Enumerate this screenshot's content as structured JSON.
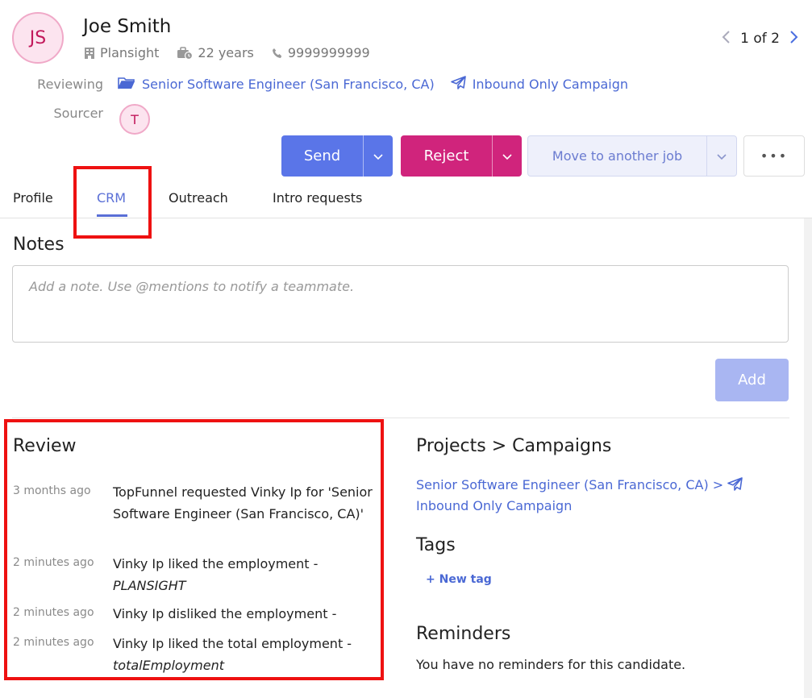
{
  "candidate": {
    "initials": "JS",
    "name": "Joe Smith",
    "company": "Plansight",
    "experience": "22 years",
    "phone": "9999999999"
  },
  "pager": {
    "text": "1 of 2"
  },
  "reviewing": {
    "label": "Reviewing",
    "job": "Senior Software Engineer (San Francisco, CA)",
    "campaign": "Inbound Only Campaign"
  },
  "sourcer": {
    "label": "Sourcer",
    "initial": "T"
  },
  "actions": {
    "send": "Send",
    "reject": "Reject",
    "move": "Move to another job",
    "more": "•••"
  },
  "tabs": [
    "Profile",
    "CRM",
    "Outreach",
    "Intro requests"
  ],
  "notes": {
    "title": "Notes",
    "placeholder": "Add a note. Use @mentions to notify a teammate.",
    "add": "Add"
  },
  "review": {
    "title": "Review",
    "items": [
      {
        "time": "3 months ago",
        "text": "TopFunnel requested Vinky Ip for 'Senior Software Engineer (San Francisco, CA)'",
        "italic": ""
      },
      {
        "time": "2 minutes ago",
        "text": "Vinky Ip liked the employment - ",
        "italic": "PLANSIGHT"
      },
      {
        "time": "2 minutes ago",
        "text": "Vinky Ip disliked the employment - ",
        "italic": ""
      },
      {
        "time": "2 minutes ago",
        "text": "Vinky Ip liked the total employment - ",
        "italic": "totalEmployment"
      }
    ]
  },
  "projects": {
    "title": "Projects > Campaigns",
    "job": "Senior Software Engineer (San Francisco, CA) >",
    "campaign": "Inbound Only Campaign"
  },
  "tags": {
    "title": "Tags",
    "new": "+ New tag"
  },
  "reminders": {
    "title": "Reminders",
    "empty": "You have no reminders for this candidate."
  },
  "colors": {
    "primary": "#5a75e8",
    "reject": "#d0247c",
    "link": "#4a68d4",
    "highlight": "#ee1111"
  }
}
